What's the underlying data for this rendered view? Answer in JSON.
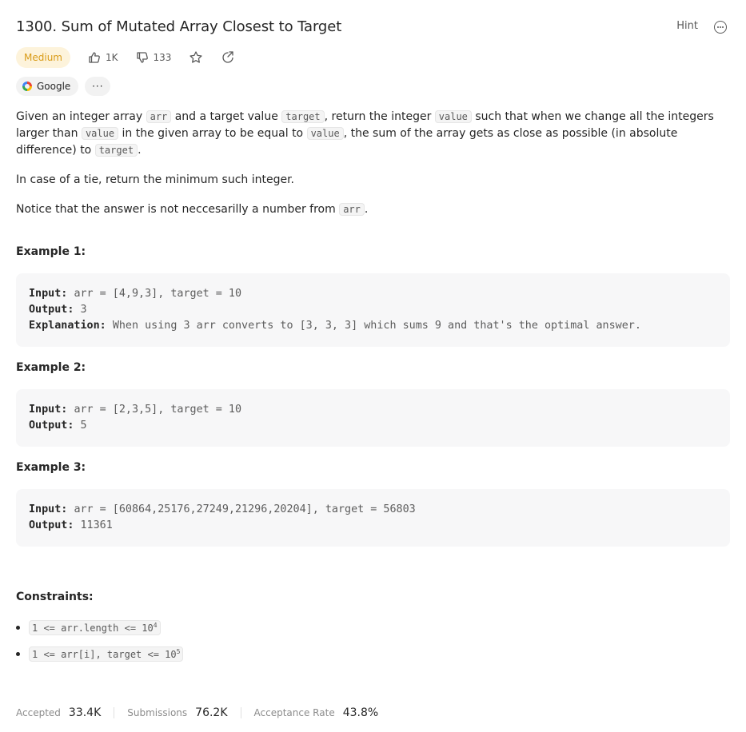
{
  "header": {
    "title": "1300. Sum of Mutated Array Closest to Target",
    "hint_label": "Hint"
  },
  "meta": {
    "difficulty": "Medium",
    "likes": "1K",
    "dislikes": "133"
  },
  "tags": {
    "company": "Google",
    "more_label": "···"
  },
  "description": {
    "p1": {
      "t1": "Given an integer array ",
      "c1": "arr",
      "t2": " and a target value ",
      "c2": "target",
      "t3": ", return the integer ",
      "c3": "value",
      "t4": " such that when we change all the integers larger than ",
      "c4": "value",
      "t5": " in the given array to be equal to ",
      "c5": "value",
      "t6": ", the sum of the array gets as close as possible (in absolute difference) to ",
      "c6": "target",
      "t7": "."
    },
    "p2": "In case of a tie, return the minimum such integer.",
    "p3": {
      "t1": "Notice that the answer is not neccesarilly a number from ",
      "c1": "arr",
      "t2": "."
    }
  },
  "examples": [
    {
      "title": "Example 1:",
      "input_label": "Input:",
      "input": "arr = [4,9,3], target = 10",
      "output_label": "Output:",
      "output": "3",
      "explanation_label": "Explanation:",
      "explanation": "When using 3 arr converts to [3, 3, 3] which sums 9 and that's the optimal answer."
    },
    {
      "title": "Example 2:",
      "input_label": "Input:",
      "input": "arr = [2,3,5], target = 10",
      "output_label": "Output:",
      "output": "5"
    },
    {
      "title": "Example 3:",
      "input_label": "Input:",
      "input": "arr = [60864,25176,27249,21296,20204], target = 56803",
      "output_label": "Output:",
      "output": "11361"
    }
  ],
  "constraints": {
    "title": "Constraints:",
    "items": [
      {
        "text": "1 <= arr.length <= 10",
        "sup": "4"
      },
      {
        "text": "1 <= arr[i], target <= 10",
        "sup": "5"
      }
    ]
  },
  "footer": {
    "accepted_label": "Accepted",
    "accepted": "33.4K",
    "submissions_label": "Submissions",
    "submissions": "76.2K",
    "rate_label": "Acceptance Rate",
    "rate": "43.8%"
  }
}
